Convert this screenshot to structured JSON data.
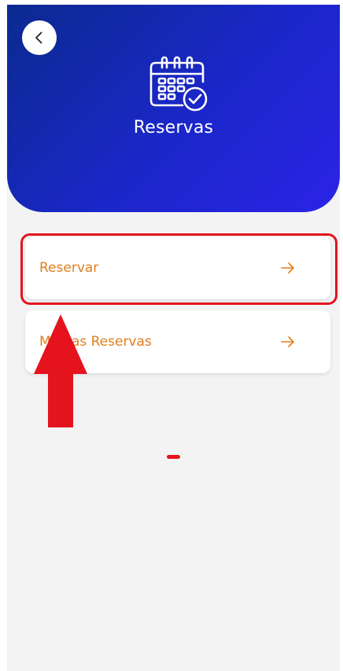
{
  "header": {
    "title": "Reservas",
    "back_icon": "chevron-left-icon",
    "title_icon": "calendar-check-icon",
    "gradient_colors": [
      "#0b2a8f",
      "#2b23e6"
    ]
  },
  "menu": {
    "items": [
      {
        "label": "Reservar",
        "icon": "arrow-right-icon"
      },
      {
        "label": "Minhas Reservas",
        "icon": "arrow-right-icon"
      }
    ]
  },
  "annotation": {
    "highlight_color": "#e4131d",
    "arrow": "up-arrow-icon"
  },
  "colors": {
    "accent": "#e07e1e",
    "background": "#f3f3f3"
  }
}
